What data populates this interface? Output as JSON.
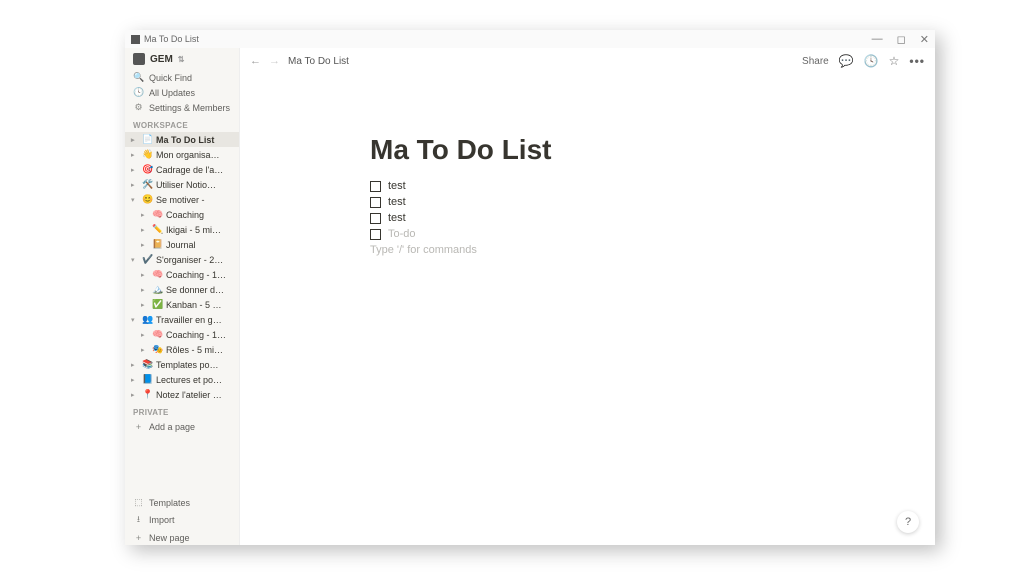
{
  "window": {
    "title": "Ma To Do List"
  },
  "workspace": {
    "name": "GEM"
  },
  "sidebarTop": {
    "quickFind": "Quick Find",
    "allUpdates": "All Updates",
    "settings": "Settings & Members"
  },
  "sections": {
    "workspace": "WORKSPACE",
    "private": "PRIVATE"
  },
  "tree": [
    {
      "caret": "▸",
      "emoji": "📄",
      "name": "Ma To Do List",
      "depth": 0,
      "selected": true
    },
    {
      "caret": "▸",
      "emoji": "👋",
      "name": "Mon organisa…",
      "depth": 0
    },
    {
      "caret": "▸",
      "emoji": "🎯",
      "name": "Cadrage de l'a…",
      "depth": 0
    },
    {
      "caret": "▸",
      "emoji": "🛠️",
      "name": "Utiliser Notio…",
      "depth": 0
    },
    {
      "caret": "▾",
      "emoji": "😊",
      "name": "Se motiver -",
      "depth": 0
    },
    {
      "caret": "▸",
      "emoji": "🧠",
      "name": "Coaching",
      "depth": 1
    },
    {
      "caret": "▸",
      "emoji": "✏️",
      "name": "Ikigai - 5 mi…",
      "depth": 1
    },
    {
      "caret": "▸",
      "emoji": "📔",
      "name": "Journal",
      "depth": 1
    },
    {
      "caret": "▾",
      "emoji": "✔️",
      "name": "S'organiser - 2…",
      "depth": 0
    },
    {
      "caret": "▸",
      "emoji": "🧠",
      "name": "Coaching - 1…",
      "depth": 1
    },
    {
      "caret": "▸",
      "emoji": "🏔️",
      "name": "Se donner d…",
      "depth": 1
    },
    {
      "caret": "▸",
      "emoji": "✅",
      "name": "Kanban - 5 …",
      "depth": 1
    },
    {
      "caret": "▾",
      "emoji": "👥",
      "name": "Travailler en g…",
      "depth": 0
    },
    {
      "caret": "▸",
      "emoji": "🧠",
      "name": "Coaching - 1…",
      "depth": 1
    },
    {
      "caret": "▸",
      "emoji": "🎭",
      "name": "Rôles - 5 mi…",
      "depth": 1
    },
    {
      "caret": "▸",
      "emoji": "📚",
      "name": "Templates po…",
      "depth": 0
    },
    {
      "caret": "▸",
      "emoji": "📘",
      "name": "Lectures et po…",
      "depth": 0
    },
    {
      "caret": "▸",
      "emoji": "📍",
      "name": "Notez l'atelier …",
      "depth": 0
    }
  ],
  "privateActions": {
    "addPage": "Add a page"
  },
  "sidebarBottom": {
    "templates": "Templates",
    "import": "Import",
    "newPage": "New page"
  },
  "topbar": {
    "breadcrumb": "Ma To Do List",
    "share": "Share"
  },
  "page": {
    "title": "Ma To Do List",
    "todos": [
      {
        "text": "test",
        "placeholder": false
      },
      {
        "text": "test",
        "placeholder": false
      },
      {
        "text": "test",
        "placeholder": false
      },
      {
        "text": "To-do",
        "placeholder": true
      }
    ],
    "commandHint": "Type '/' for commands"
  },
  "help": "?"
}
